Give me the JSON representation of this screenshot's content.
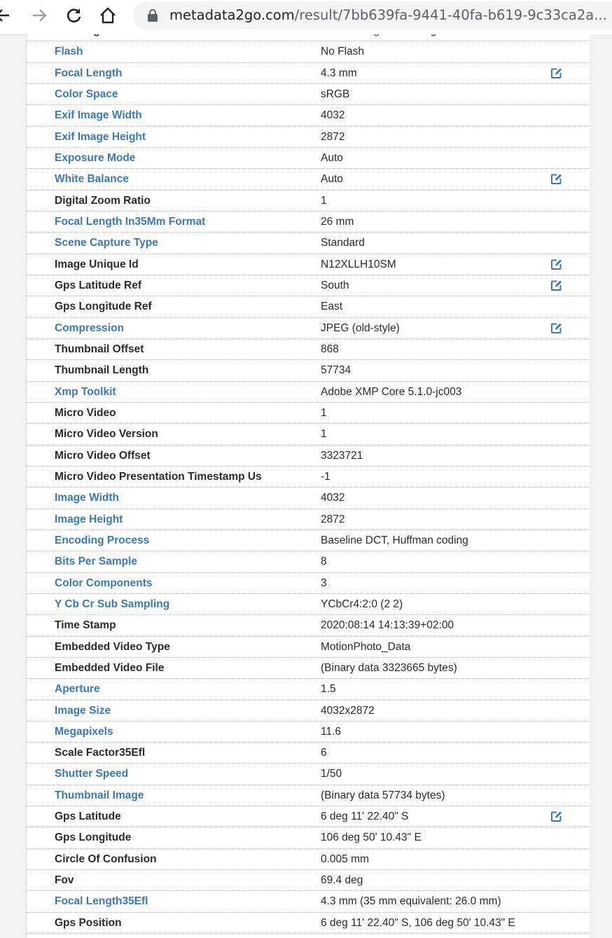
{
  "browser": {
    "url_host": "metadata2go.com",
    "url_path": "/result/7bb639fa-9441-40fa-b619-9c33ca2a..."
  },
  "rows": [
    {
      "label": "Metering Mode",
      "value": "Center-weighted average",
      "link": false,
      "edit": false
    },
    {
      "label": "Flash",
      "value": "No Flash",
      "link": true,
      "edit": false
    },
    {
      "label": "Focal Length",
      "value": "4.3 mm",
      "link": true,
      "edit": true
    },
    {
      "label": "Color Space",
      "value": "sRGB",
      "link": true,
      "edit": false
    },
    {
      "label": "Exif Image Width",
      "value": "4032",
      "link": true,
      "edit": false
    },
    {
      "label": "Exif Image Height",
      "value": "2872",
      "link": true,
      "edit": false
    },
    {
      "label": "Exposure Mode",
      "value": "Auto",
      "link": true,
      "edit": false
    },
    {
      "label": "White Balance",
      "value": "Auto",
      "link": true,
      "edit": true
    },
    {
      "label": "Digital Zoom Ratio",
      "value": "1",
      "link": false,
      "edit": false
    },
    {
      "label": "Focal Length In35Mm Format",
      "value": "26 mm",
      "link": true,
      "edit": false
    },
    {
      "label": "Scene Capture Type",
      "value": "Standard",
      "link": true,
      "edit": false
    },
    {
      "label": "Image Unique Id",
      "value": "N12XLLH10SM",
      "link": false,
      "edit": true
    },
    {
      "label": "Gps Latitude Ref",
      "value": "South",
      "link": false,
      "edit": true
    },
    {
      "label": "Gps Longitude Ref",
      "value": "East",
      "link": false,
      "edit": false
    },
    {
      "label": "Compression",
      "value": "JPEG (old-style)",
      "link": true,
      "edit": true
    },
    {
      "label": "Thumbnail Offset",
      "value": "868",
      "link": false,
      "edit": false
    },
    {
      "label": "Thumbnail Length",
      "value": "57734",
      "link": false,
      "edit": false
    },
    {
      "label": "Xmp Toolkit",
      "value": "Adobe XMP Core 5.1.0-jc003",
      "link": true,
      "edit": false
    },
    {
      "label": "Micro Video",
      "value": "1",
      "link": false,
      "edit": false
    },
    {
      "label": "Micro Video Version",
      "value": "1",
      "link": false,
      "edit": false
    },
    {
      "label": "Micro Video Offset",
      "value": "3323721",
      "link": false,
      "edit": false
    },
    {
      "label": "Micro Video Presentation Timestamp Us",
      "value": "-1",
      "link": false,
      "edit": false
    },
    {
      "label": "Image Width",
      "value": "4032",
      "link": true,
      "edit": false
    },
    {
      "label": "Image Height",
      "value": "2872",
      "link": true,
      "edit": false
    },
    {
      "label": "Encoding Process",
      "value": "Baseline DCT, Huffman coding",
      "link": true,
      "edit": false
    },
    {
      "label": "Bits Per Sample",
      "value": "8",
      "link": true,
      "edit": false
    },
    {
      "label": "Color Components",
      "value": "3",
      "link": true,
      "edit": false
    },
    {
      "label": "Y Cb Cr Sub Sampling",
      "value": "YCbCr4:2:0 (2 2)",
      "link": true,
      "edit": false
    },
    {
      "label": "Time Stamp",
      "value": "2020:08:14 14:13:39+02:00",
      "link": false,
      "edit": false
    },
    {
      "label": "Embedded Video Type",
      "value": "MotionPhoto_Data",
      "link": false,
      "edit": false
    },
    {
      "label": "Embedded Video File",
      "value": "(Binary data 3323665 bytes)",
      "link": false,
      "edit": false
    },
    {
      "label": "Aperture",
      "value": "1.5",
      "link": true,
      "edit": false
    },
    {
      "label": "Image Size",
      "value": "4032x2872",
      "link": true,
      "edit": false
    },
    {
      "label": "Megapixels",
      "value": "11.6",
      "link": true,
      "edit": false
    },
    {
      "label": "Scale Factor35Efl",
      "value": "6",
      "link": false,
      "edit": false
    },
    {
      "label": "Shutter Speed",
      "value": "1/50",
      "link": true,
      "edit": false
    },
    {
      "label": "Thumbnail Image",
      "value": "(Binary data 57734 bytes)",
      "link": true,
      "edit": false
    },
    {
      "label": "Gps Latitude",
      "value": "6 deg 11' 22.40\" S",
      "link": false,
      "edit": true
    },
    {
      "label": "Gps Longitude",
      "value": "106 deg 50' 10.43\" E",
      "link": false,
      "edit": false
    },
    {
      "label": "Circle Of Confusion",
      "value": "0.005 mm",
      "link": false,
      "edit": false
    },
    {
      "label": "Fov",
      "value": "69.4 deg",
      "link": false,
      "edit": false
    },
    {
      "label": "Focal Length35Efl",
      "value": "4.3 mm (35 mm equivalent: 26.0 mm)",
      "link": true,
      "edit": false
    },
    {
      "label": "Gps Position",
      "value": "6 deg 11' 22.40\" S, 106 deg 50' 10.43\" E",
      "link": false,
      "edit": false
    }
  ],
  "colors": {
    "link": "#3b78b8",
    "text": "#2b2b2b",
    "edit_icon": "#3b78b8"
  },
  "icons": {
    "edit": "edit-pencil-icon"
  }
}
